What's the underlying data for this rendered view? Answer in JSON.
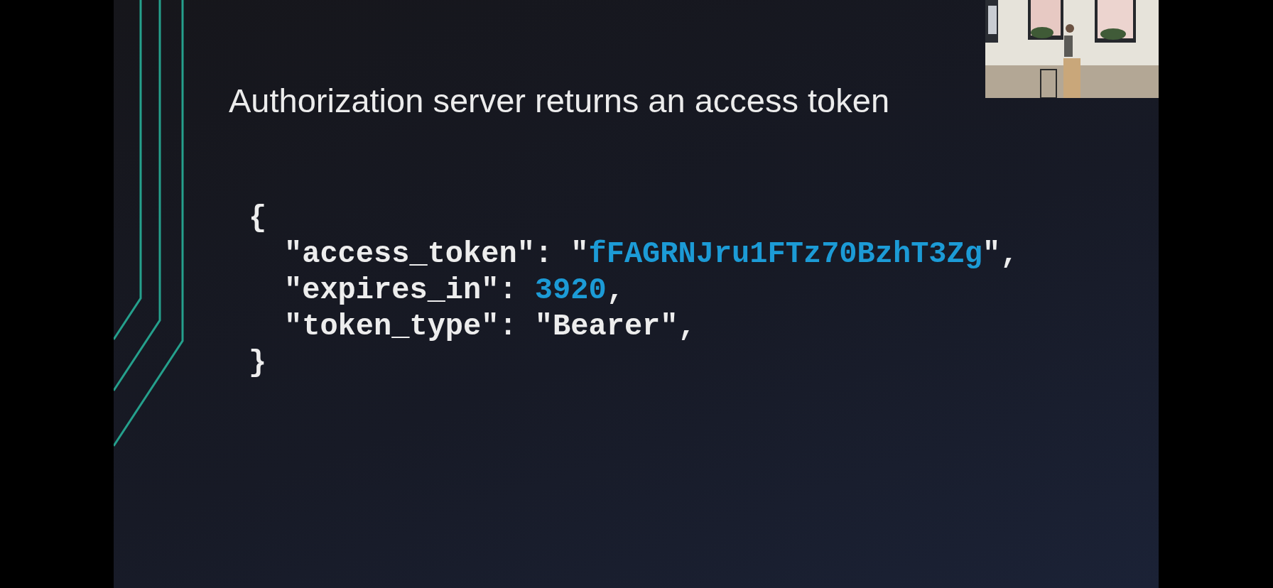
{
  "slide": {
    "title": "Authorization server returns an access token",
    "code": [
      {
        "segments": [
          {
            "text": "{",
            "kind": "plain"
          }
        ],
        "children": [
          {
            "segments": [
              {
                "text": "\"access_token\": \"",
                "kind": "plain"
              },
              {
                "text": "fFAGRNJru1FTz70BzhT3Zg",
                "kind": "value"
              },
              {
                "text": "\",",
                "kind": "plain"
              }
            ]
          },
          {
            "segments": [
              {
                "text": "\"expires_in\": ",
                "kind": "plain"
              },
              {
                "text": "3920",
                "kind": "value"
              },
              {
                "text": ",",
                "kind": "plain"
              }
            ]
          },
          {
            "segments": [
              {
                "text": "\"token_type\": \"Bearer\",",
                "kind": "plain"
              }
            ]
          }
        ]
      },
      {
        "segments": [
          {
            "text": "}",
            "kind": "plain"
          }
        ]
      }
    ]
  }
}
